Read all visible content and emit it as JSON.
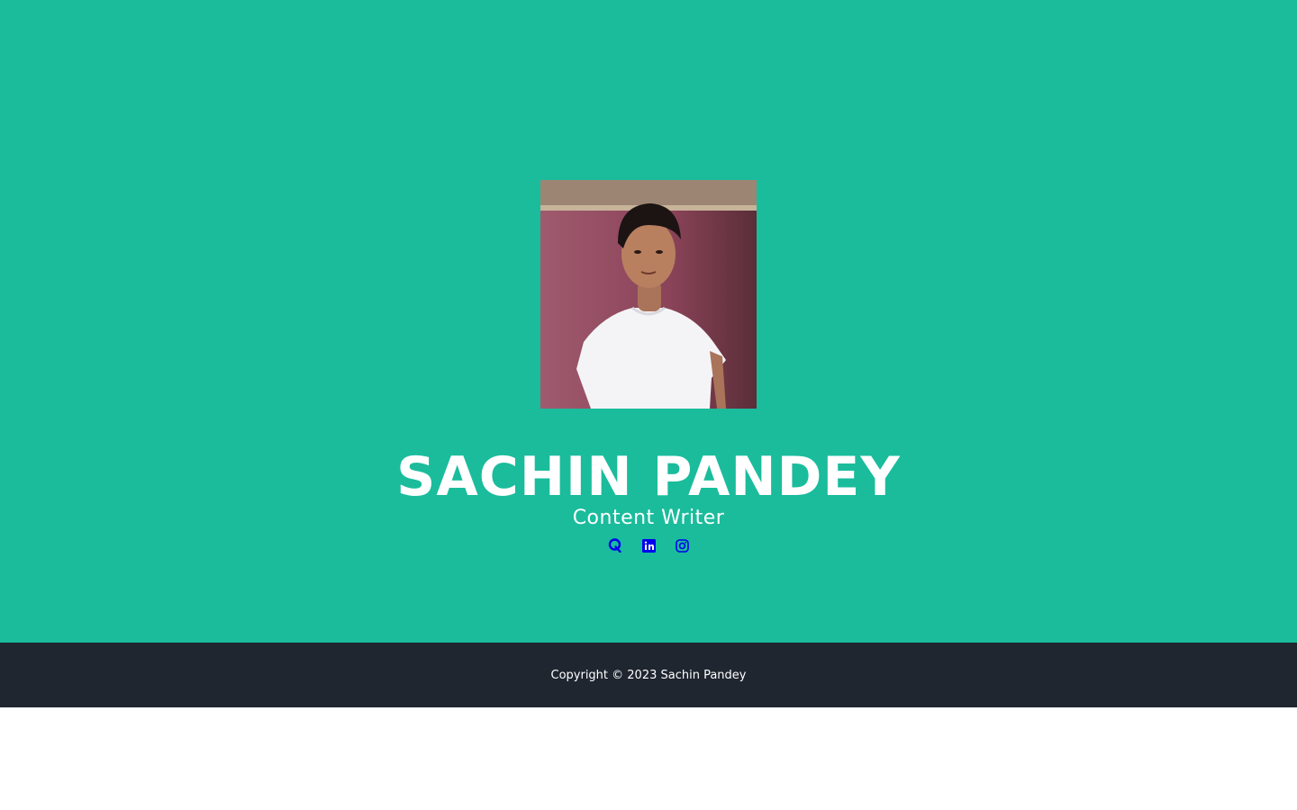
{
  "profile": {
    "name": "SACHIN PANDEY",
    "role": "Content Writer",
    "avatar_alt": "profile-photo"
  },
  "socials": [
    {
      "icon": "quora-icon"
    },
    {
      "icon": "linkedin-icon"
    },
    {
      "icon": "instagram-icon"
    }
  ],
  "footer": {
    "copyright": "Copyright © 2023 Sachin Pandey"
  },
  "colors": {
    "hero_background": "#1abc9c",
    "footer_background": "#1f2630",
    "link": "#0000ee",
    "text": "#ffffff"
  }
}
